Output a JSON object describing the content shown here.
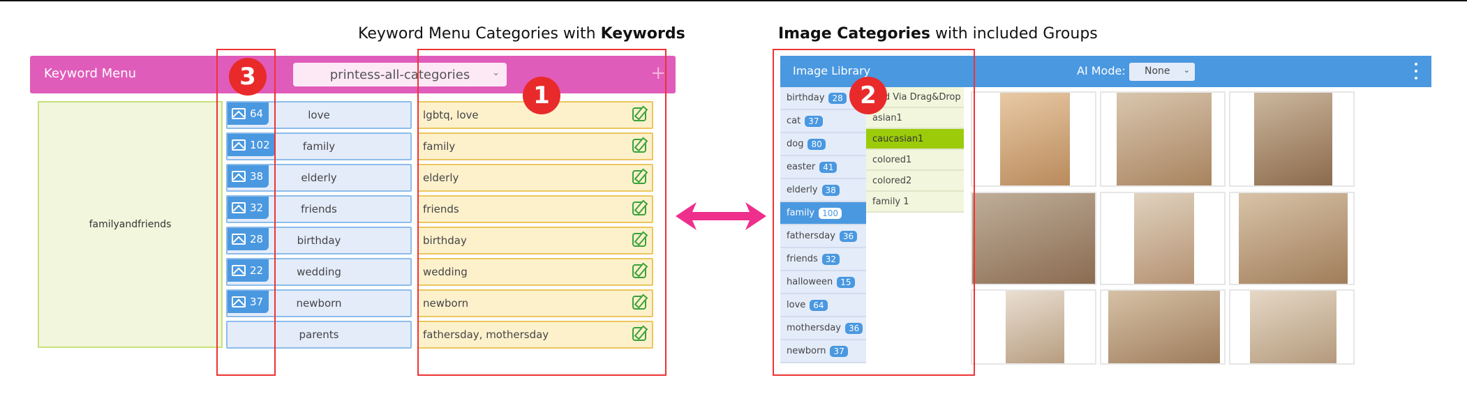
{
  "captions": {
    "left_prefix": "Keyword Menu Categories with ",
    "left_bold": "Keywords",
    "right_bold": "Image Categories",
    "right_suffix": " with included Groups"
  },
  "callouts": [
    "1",
    "2",
    "3"
  ],
  "keyword_menu": {
    "title": "Keyword Menu",
    "selected_category": "printess-all-categories",
    "add_icon": "plus-icon",
    "group": "familyandfriends",
    "rows": [
      {
        "count": "64",
        "name": "love",
        "keywords": "lgbtq, love"
      },
      {
        "count": "102",
        "name": "family",
        "keywords": "family"
      },
      {
        "count": "38",
        "name": "elderly",
        "keywords": "elderly"
      },
      {
        "count": "32",
        "name": "friends",
        "keywords": "friends"
      },
      {
        "count": "28",
        "name": "birthday",
        "keywords": "birthday"
      },
      {
        "count": "22",
        "name": "wedding",
        "keywords": "wedding"
      },
      {
        "count": "37",
        "name": "newborn",
        "keywords": "newborn"
      },
      {
        "count": null,
        "name": "parents",
        "keywords": "fathersday, mothersday"
      }
    ]
  },
  "image_library": {
    "title": "Image Library",
    "ai_mode_label": "AI Mode:",
    "ai_mode_value": "None",
    "categories": [
      {
        "name": "birthday",
        "count": "28"
      },
      {
        "name": "cat",
        "count": "37"
      },
      {
        "name": "dog",
        "count": "80"
      },
      {
        "name": "easter",
        "count": "41"
      },
      {
        "name": "elderly",
        "count": "38"
      },
      {
        "name": "family",
        "count": "100",
        "active": true
      },
      {
        "name": "fathersday",
        "count": "36"
      },
      {
        "name": "friends",
        "count": "32"
      },
      {
        "name": "halloween",
        "count": "15"
      },
      {
        "name": "love",
        "count": "64"
      },
      {
        "name": "mothersday",
        "count": "36"
      },
      {
        "name": "newborn",
        "count": "37"
      }
    ],
    "groups": [
      {
        "name": "Add Via Drag&Drop"
      },
      {
        "name": "asian1"
      },
      {
        "name": "caucasian1",
        "active": true
      },
      {
        "name": "colored1"
      },
      {
        "name": "colored2"
      },
      {
        "name": "family 1"
      }
    ]
  },
  "colors": {
    "keyword_header": "#e05cba",
    "library_header": "#4a98e0",
    "active_group": "#9ccb0a",
    "callout": "#e92a2a",
    "arrow": "#ee2f8c"
  }
}
